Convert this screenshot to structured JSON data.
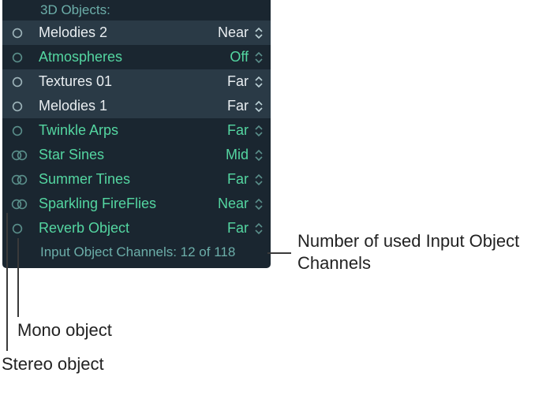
{
  "panel": {
    "section_header": "3D Objects:",
    "rows": [
      {
        "icon": "mono",
        "name": "Melodies 2",
        "value": "Near",
        "selected": true,
        "tone": "white"
      },
      {
        "icon": "mono",
        "name": "Atmospheres",
        "value": "Off",
        "selected": false,
        "tone": "green"
      },
      {
        "icon": "mono",
        "name": "Textures 01",
        "value": "Far",
        "selected": true,
        "tone": "white"
      },
      {
        "icon": "mono",
        "name": "Melodies 1",
        "value": "Far",
        "selected": true,
        "tone": "white"
      },
      {
        "icon": "mono",
        "name": "Twinkle Arps",
        "value": "Far",
        "selected": false,
        "tone": "green"
      },
      {
        "icon": "stereo",
        "name": "Star Sines",
        "value": "Mid",
        "selected": false,
        "tone": "green"
      },
      {
        "icon": "stereo",
        "name": "Summer Tines",
        "value": "Far",
        "selected": false,
        "tone": "green"
      },
      {
        "icon": "stereo",
        "name": "Sparkling FireFlies",
        "value": "Near",
        "selected": false,
        "tone": "green"
      },
      {
        "icon": "mono",
        "name": "Reverb Object",
        "value": "Far",
        "selected": false,
        "tone": "green"
      }
    ],
    "footer": "Input Object Channels: 12 of 118"
  },
  "callouts": {
    "channels": "Number of used Input Object Channels",
    "mono": "Mono object",
    "stereo": "Stereo object"
  },
  "colors": {
    "panel_bg": "#1a2630",
    "row_sel_bg": "#2a3a46",
    "text_green": "#54d6a1",
    "text_muted_green": "#6caea9",
    "text_white": "#e9eef1"
  }
}
